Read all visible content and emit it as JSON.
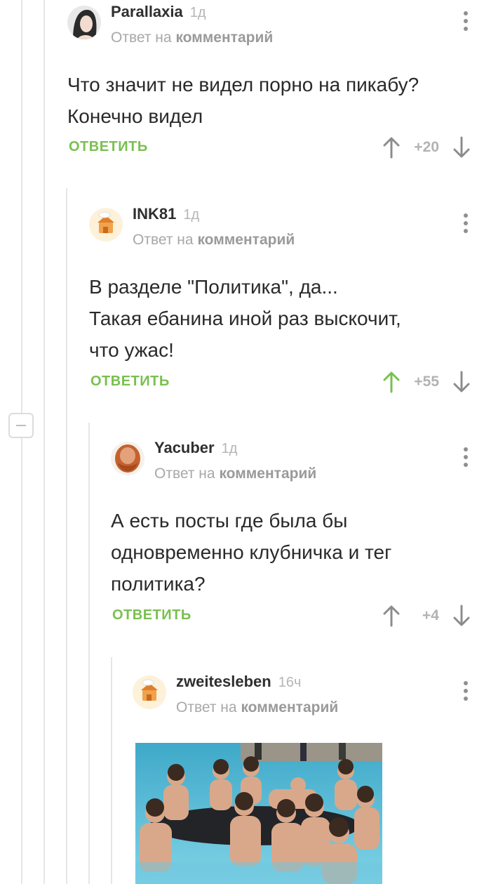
{
  "comments": [
    {
      "author": "Parallaxia",
      "time": "1д",
      "reply_prefix": "Ответ на",
      "reply_link": "комментарий",
      "lines": [
        "Что значит не видел порно на пикабу?",
        "Конечно видел"
      ],
      "reply_label": "ОТВЕТИТЬ",
      "score": "+20",
      "upvoted": false
    },
    {
      "author": "INK81",
      "time": "1д",
      "reply_prefix": "Ответ на",
      "reply_link": "комментарий",
      "lines": [
        "В разделе \"Политика\", да...",
        "Такая ебанина иной раз выскочит,",
        "что ужас!"
      ],
      "reply_label": "ОТВЕТИТЬ",
      "score": "+55",
      "upvoted": true
    },
    {
      "author": "Yacuber",
      "time": "1д",
      "reply_prefix": "Ответ на",
      "reply_link": "комментарий",
      "lines": [
        "А есть посты где была бы",
        "одновременно клубничка и тег",
        "политика?"
      ],
      "reply_label": "ОТВЕТИТЬ",
      "score": "+4",
      "upvoted": false
    },
    {
      "author": "zweitesleben",
      "time": "16ч",
      "reply_prefix": "Ответ на",
      "reply_link": "комментарий"
    }
  ],
  "colors": {
    "accent_green": "#79c04f",
    "muted": "#b3b3b3",
    "thread_line": "#e6e6e6"
  },
  "icons": {
    "collapse": "minus-square-icon",
    "menu": "vertical-dots-icon",
    "vote_up": "arrow-up-icon",
    "vote_down": "arrow-down-icon"
  }
}
